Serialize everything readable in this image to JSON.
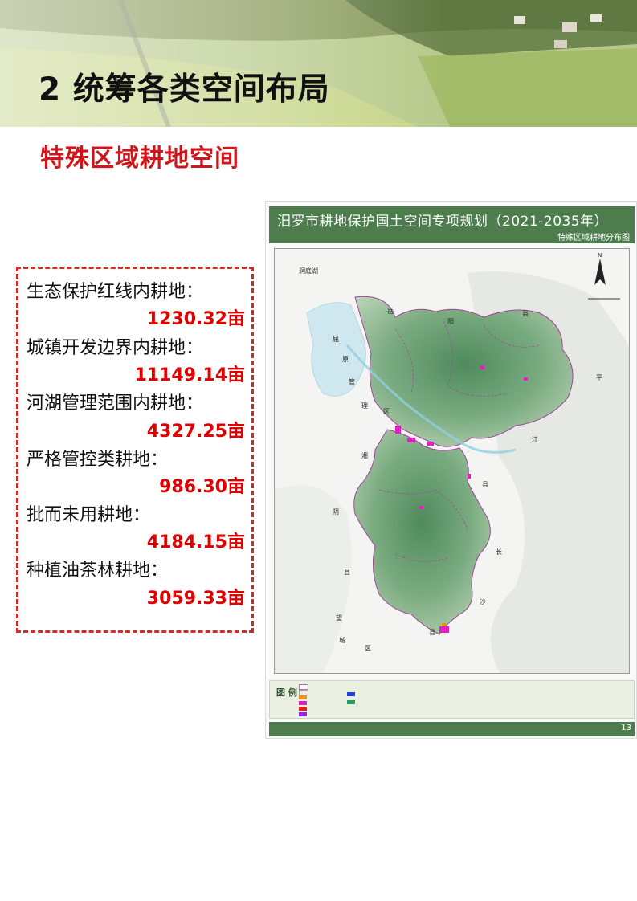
{
  "banner": {
    "title": "2 统筹各类空间布局"
  },
  "section": {
    "title": "特殊区域耕地空间"
  },
  "stats": [
    {
      "label": "生态保护红线内耕地：",
      "value": "1230.32亩"
    },
    {
      "label": "城镇开发边界内耕地：",
      "value": "11149.14亩"
    },
    {
      "label": "河湖管理范围内耕地：",
      "value": "4327.25亩"
    },
    {
      "label": "严格管控类耕地：",
      "value": "986.30亩"
    },
    {
      "label": "批而未用耕地：",
      "value": "4184.15亩"
    },
    {
      "label": "种植油茶林耕地：",
      "value": "3059.33亩"
    }
  ],
  "map": {
    "title": "汨罗市耕地保护国土空间专项规划（2021-2035年）",
    "subtitle": "特殊区域耕地分布图",
    "legend_label": "图 例",
    "page_number": "13",
    "place_names": {
      "dongting": "洞庭湖",
      "yue": "岳",
      "yang": "阳",
      "xian1": "县",
      "qu": "屈",
      "yuan": "原",
      "guan": "管",
      "li": "理",
      "qu2": "区",
      "ping": "平",
      "jiang": "江",
      "xian2": "县",
      "xiang": "湘",
      "yin": "阴",
      "xian3": "县",
      "chang": "长",
      "sha": "沙",
      "xian4": "县",
      "wang": "望",
      "cheng": "城",
      "qu3": "区"
    },
    "colors": {
      "header_green": "#4e7d4d",
      "terrain": "#6f9f78",
      "boundary": "#a0449a",
      "highlight": "#e020c0",
      "water": "#bfe3ec"
    }
  }
}
